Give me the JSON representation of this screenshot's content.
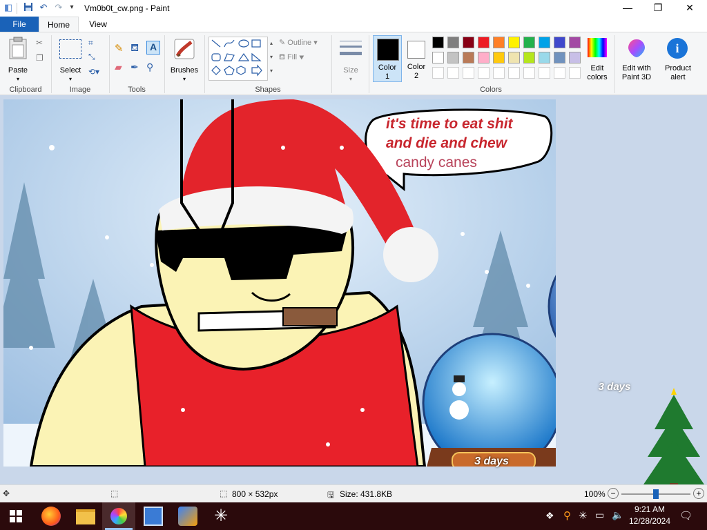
{
  "window": {
    "title": "Vm0b0t_cw.png - Paint",
    "quick_access": {
      "save": "save-icon",
      "undo": "undo-icon",
      "redo": "redo-icon",
      "customize": "▾"
    }
  },
  "tabs": [
    "File",
    "Home",
    "View"
  ],
  "ribbon": {
    "clipboard": {
      "paste_label": "Paste",
      "group_label": "Clipboard"
    },
    "image": {
      "select_label": "Select",
      "group_label": "Image"
    },
    "tools": {
      "group_label": "Tools"
    },
    "brushes": {
      "label": "Brushes"
    },
    "shapes": {
      "group_label": "Shapes",
      "outline_label": "Outline",
      "fill_label": "Fill"
    },
    "size": {
      "label": "Size"
    },
    "colors": {
      "color1_label": "Color\n1",
      "color1_line1": "Color",
      "color1_line2": "1",
      "color2_line1": "Color",
      "color2_line2": "2",
      "group_label": "Colors",
      "edit_colors_line1": "Edit",
      "edit_colors_line2": "colors",
      "palette_row1": [
        "#000000",
        "#7f7f7f",
        "#880015",
        "#ed1c24",
        "#ff7f27",
        "#fff200",
        "#22b14c",
        "#00a2e8",
        "#3f48cc",
        "#a349a4"
      ],
      "palette_row2": [
        "#ffffff",
        "#c3c3c3",
        "#b97a57",
        "#ffaec9",
        "#ffc90e",
        "#efe4b0",
        "#b5e61d",
        "#99d9ea",
        "#7092be",
        "#c8bfe7"
      ],
      "color1": "#000000",
      "color2": "#ffffff"
    },
    "paint3d": {
      "line1": "Edit with",
      "line2": "Paint 3D"
    },
    "product_alert": {
      "line1": "Product",
      "line2": "alert"
    }
  },
  "canvas": {
    "speech_line1": "it's time to eat shit",
    "speech_line2": "and die and chew",
    "speech_line3": "candy canes",
    "globe_small_label": "3 days",
    "globe_large_label": "3 days"
  },
  "status": {
    "dimensions": "800 × 532px",
    "size": "Size: 431.8KB",
    "zoom": "100%"
  },
  "taskbar": {
    "time": "9:21 AM",
    "date": "12/28/2024"
  }
}
